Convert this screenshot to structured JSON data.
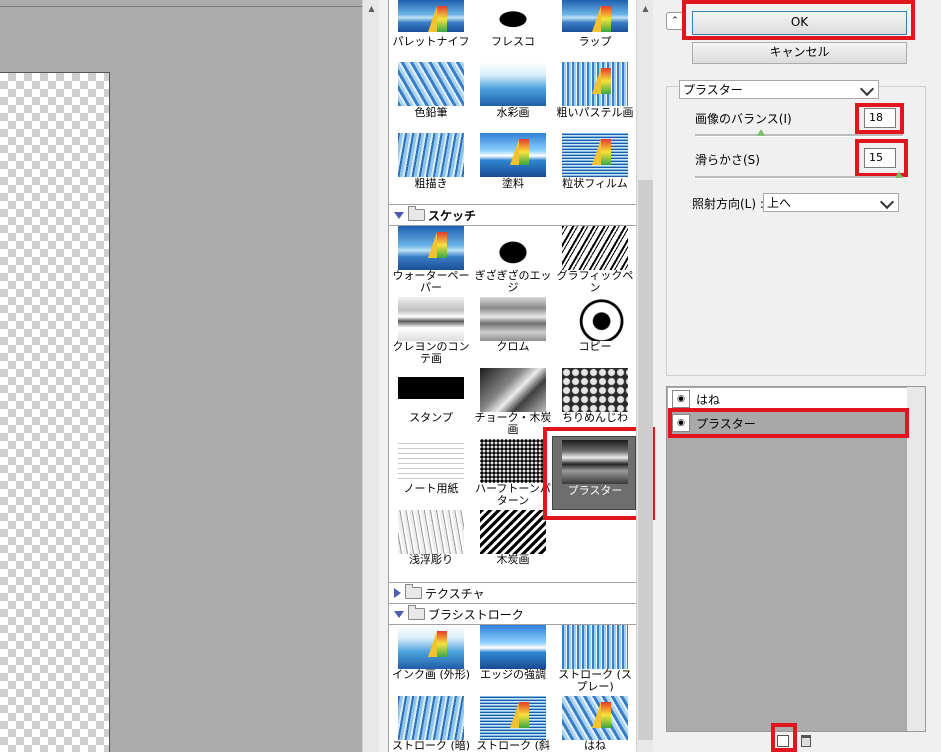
{
  "buttons": {
    "ok": "OK",
    "cancel": "キャンセル",
    "collapse": "⌃"
  },
  "filter_select": "プラスター",
  "params": {
    "balance_label": "画像のバランス(I)",
    "balance_value": "18",
    "balance_level": 18,
    "smooth_label": "滑らかさ(S)",
    "smooth_value": "15",
    "smooth_level": 15,
    "light_label": "照射方向(L) :",
    "light_value": "上へ"
  },
  "sections": {
    "sketch": "スケッチ",
    "texture": "テクスチャ",
    "brush": "ブラシストローク"
  },
  "art_labels": [
    "パレットナイフ",
    "フレスコ",
    "ラップ",
    "色鉛筆",
    "水彩画",
    "粗いパステル画",
    "粗描き",
    "塗料",
    "粒状フィルム"
  ],
  "sketch_labels": [
    "ウォーターペーパー",
    "ぎざぎざのエッジ",
    "グラフィックペン",
    "クレヨンのコンテ画",
    "クロム",
    "コピー",
    "スタンプ",
    "チョーク・木炭画",
    "ちりめんじわ",
    "ノート用紙",
    "ハーフトーンパターン",
    "プラスター",
    "浅浮彫り",
    "木炭画"
  ],
  "brush_labels": [
    "インク画 (外形)",
    "エッジの強調",
    "ストローク (スプレー)",
    "ストローク (暗)",
    "ストローク (斜め)",
    "はね"
  ],
  "layers": [
    "はね",
    "プラスター"
  ],
  "icons": {
    "new_layer": "new-effect-layer-icon",
    "delete": "trash-icon",
    "eye": "eye-icon"
  },
  "highlight_color": "#e0161c"
}
